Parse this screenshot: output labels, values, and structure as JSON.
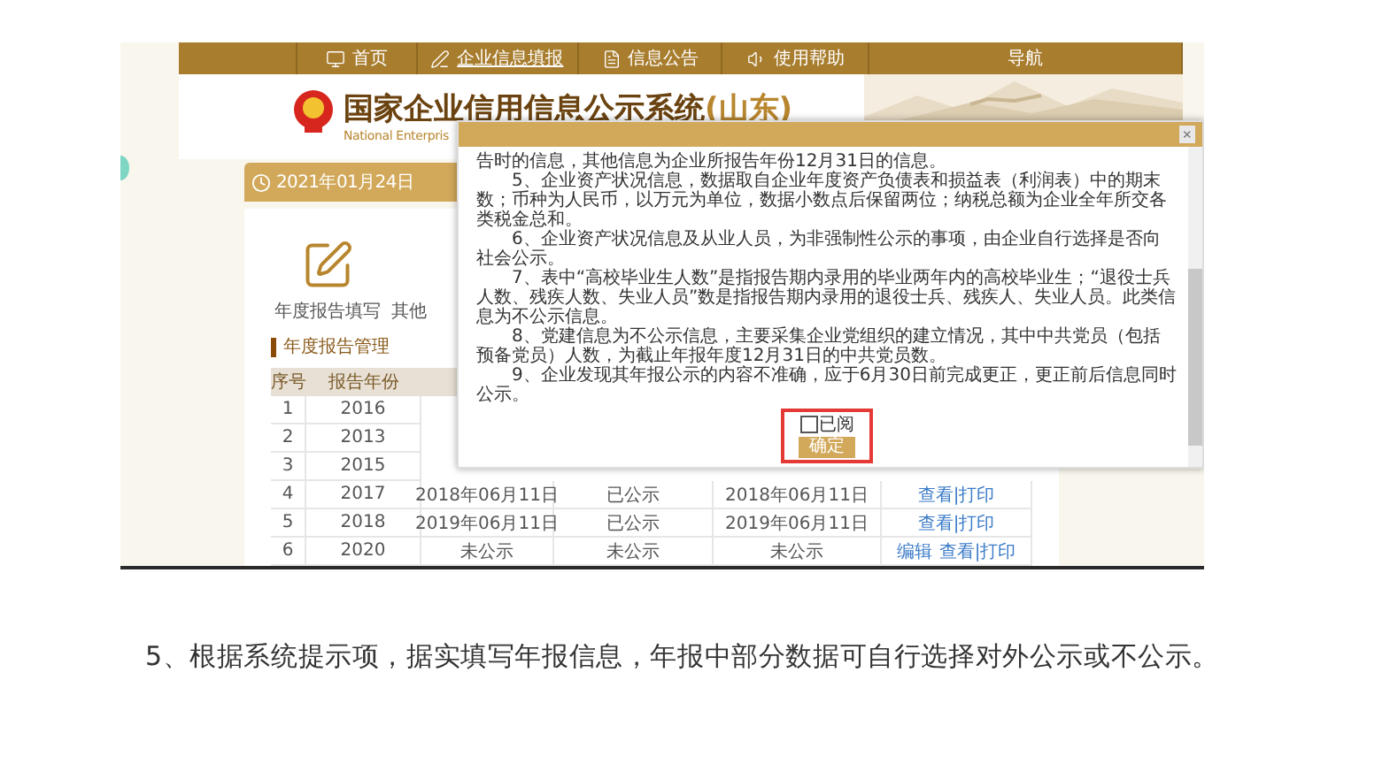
{
  "nav": {
    "items": [
      {
        "label": "首页",
        "selected": false
      },
      {
        "label": "企业信息填报",
        "selected": true
      },
      {
        "label": "信息公告",
        "selected": false
      },
      {
        "label": "使用帮助",
        "selected": false
      },
      {
        "label": "导航",
        "selected": false
      }
    ]
  },
  "header": {
    "title": "国家企业信用信息公示系统",
    "region": "(山东)",
    "subtitle": "National Enterpris"
  },
  "date": "2021年01月24日",
  "tiles": [
    {
      "label": "年度报告填写",
      "icon": true
    },
    {
      "label": "其他",
      "icon": false
    }
  ],
  "section_title": "年度报告管理",
  "table": {
    "columns": [
      "序号",
      "报告年份"
    ],
    "rows": [
      {
        "cells": [
          "1",
          "2016"
        ],
        "actions": []
      },
      {
        "cells": [
          "2",
          "2013"
        ],
        "actions": []
      },
      {
        "cells": [
          "3",
          "2015"
        ],
        "actions": []
      },
      {
        "cells": [
          "4",
          "2017",
          "2018年06月11日",
          "已公示",
          "2018年06月11日"
        ],
        "actions": [
          "查看|打印"
        ]
      },
      {
        "cells": [
          "5",
          "2018",
          "2019年06月11日",
          "已公示",
          "2019年06月11日"
        ],
        "actions": [
          "查看|打印"
        ]
      },
      {
        "cells": [
          "6",
          "2020",
          "未公示",
          "未公示",
          "未公示"
        ],
        "actions": [
          "编辑",
          "查看|打印"
        ]
      }
    ]
  },
  "modal": {
    "close": "×",
    "paragraphs": [
      "告时的信息，其他信息为企业所报告年份12月31日的信息。",
      "5、企业资产状况信息，数据取自企业年度资产负债表和损益表（利润表）中的期末数；币种为人民币，以万元为单位，数据小数点后保留两位；纳税总额为企业全年所交各类税金总和。",
      "6、企业资产状况信息及从业人员，为非强制性公示的事项，由企业自行选择是否向社会公示。",
      "7、表中“高校毕业生人数”是指报告期内录用的毕业两年内的高校毕业生；“退役士兵人数、残疾人数、失业人员”数是指报告期内录用的退役士兵、残疾人、失业人员。此类信息为不公示信息。",
      "8、党建信息为不公示信息，主要采集企业党组织的建立情况，其中中共党员（包括预备党员）人数，为截止年报年度12月31日的中共党员数。",
      "9、企业发现其年报公示的内容不准确，应于6月30日前完成更正，更正前后信息同时公示。"
    ],
    "checkbox": {
      "label": "已阅",
      "checked": false
    },
    "button": "确定"
  },
  "article": "5、根据系统提示项，据实填写年报信息，年报中部分数据可自行选择对外公示或不公示。"
}
